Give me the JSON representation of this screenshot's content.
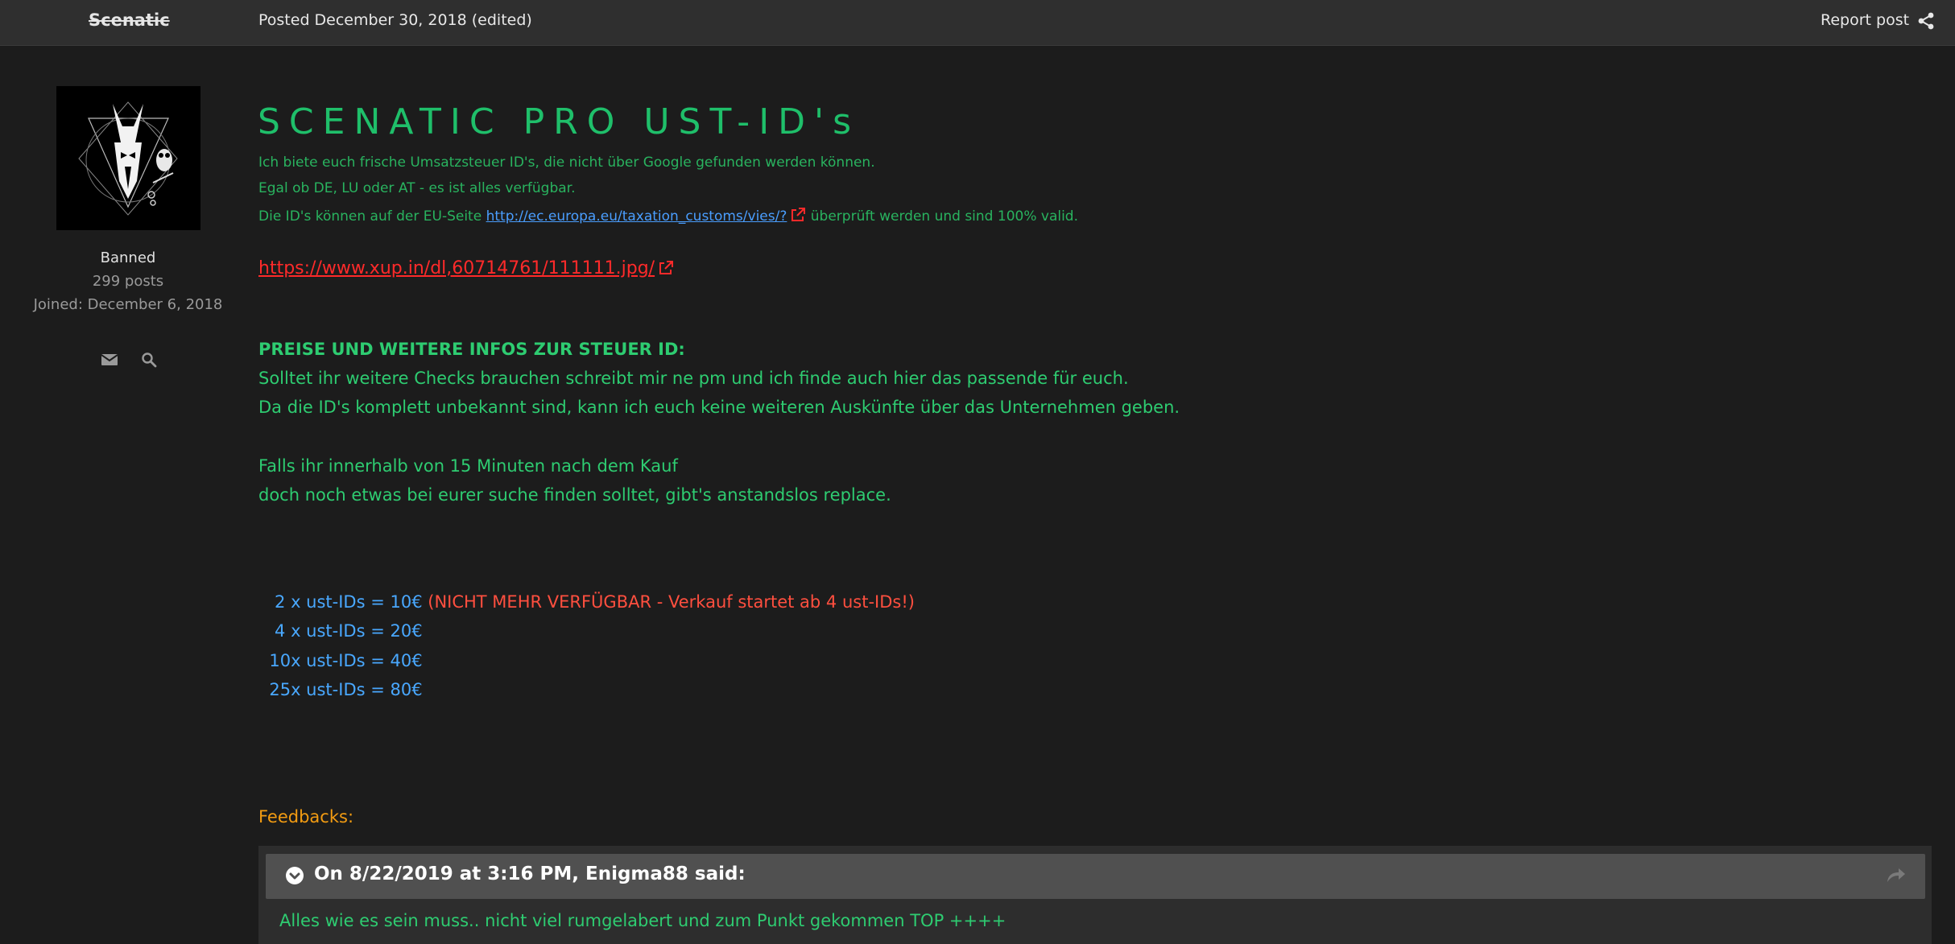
{
  "header": {
    "author": "Scenatic",
    "posted": "Posted December 30, 2018 (edited)",
    "report_label": "Report post"
  },
  "sidebar": {
    "rank": "Banned",
    "posts": "299 posts",
    "joined": "Joined: December 6, 2018"
  },
  "post": {
    "title": "SCENATIC PRO UST-ID's",
    "intro_1": "Ich biete euch frische Umsatzsteuer ID's, die nicht über Google gefunden werden können.",
    "intro_2": "Egal ob DE, LU oder AT - es ist alles verfügbar.",
    "intro_3_prefix": "Die ID's können auf der EU-Seite ",
    "eu_link": "http://ec.europa.eu/taxation_customs/vies/?",
    "intro_3_suffix": " überprüft werden und sind 100% valid.",
    "xup_link": "https://www.xup.in/dl,60714761/111111.jpg/",
    "heading": "PREISE UND WEITERE INFOS ZUR STEUER ID:",
    "para1_line1": "Solltet ihr weitere Checks brauchen schreibt mir ne pm und ich finde auch hier das passende für euch.",
    "para1_line2": "Da die ID's komplett unbekannt sind, kann ich euch keine weiteren Auskünfte über das Unternehmen geben.",
    "para2_line1": "Falls ihr innerhalb von 15 Minuten nach dem Kauf",
    "para2_line2": "doch noch etwas bei eurer suche finden solltet, gibt's anstandslos replace.",
    "prices": [
      {
        "text": " 2 x ust-IDs = 10€",
        "note": " (NICHT MEHR VERFÜGBAR - Verkauf startet ab 4 ust-IDs!)"
      },
      {
        "text": " 4 x ust-IDs = 20€",
        "note": ""
      },
      {
        "text": "10x ust-IDs = 40€",
        "note": ""
      },
      {
        "text": "25x ust-IDs = 80€",
        "note": ""
      }
    ],
    "feedbacks_label": "Feedbacks:",
    "quote": {
      "citation": "On 8/22/2019 at 3:16 PM, Enigma88 said:",
      "text": "Alles wie es sein muss.. nicht viel rumgelabert und zum Punkt gekommen TOP ++++"
    }
  },
  "colors": {
    "background": "#1c1c1c",
    "header_bg": "#2f2f2f",
    "green": "#2ecc71",
    "blue_link": "#4a9eff",
    "red_link": "#ff2a2a",
    "orange": "#f39c12"
  },
  "icons": [
    "share-icon",
    "mail-icon",
    "search-icon",
    "external-link-icon",
    "chevron-down-icon",
    "quote-share-icon"
  ]
}
